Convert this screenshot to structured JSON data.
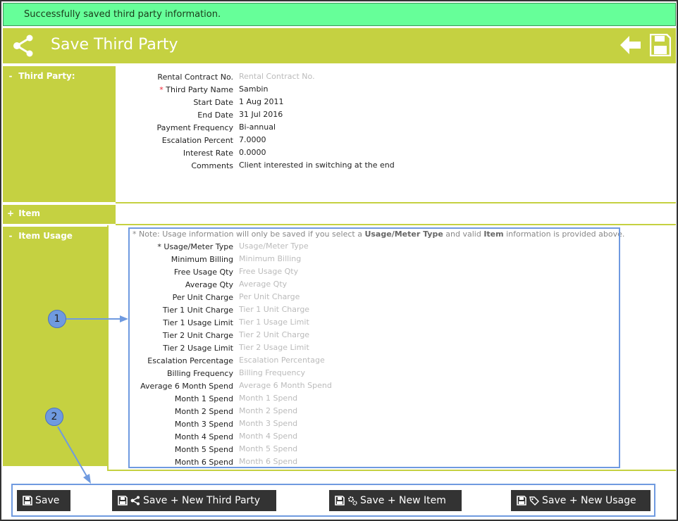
{
  "notification": "Successfully saved third party information.",
  "header": {
    "title": "Save Third Party"
  },
  "sections": {
    "third_party": {
      "toggle": "-",
      "label": "Third Party:"
    },
    "item": {
      "toggle": "+",
      "label": "Item"
    },
    "item_usage": {
      "toggle": "-",
      "label": "Item Usage"
    }
  },
  "third_party_fields": [
    {
      "label": "Rental Contract No.",
      "value": "Rental Contract No.",
      "placeholder": true,
      "required": false
    },
    {
      "label": "Third Party Name",
      "value": "Sambin",
      "placeholder": false,
      "required": true
    },
    {
      "label": "Start Date",
      "value": "1 Aug 2011",
      "placeholder": false,
      "required": false
    },
    {
      "label": "End Date",
      "value": "31 Jul 2016",
      "placeholder": false,
      "required": false
    },
    {
      "label": "Payment Frequency",
      "value": "Bi-annual",
      "placeholder": false,
      "required": false
    },
    {
      "label": "Escalation Percent",
      "value": "7.0000",
      "placeholder": false,
      "required": false
    },
    {
      "label": "Interest Rate",
      "value": "0.0000",
      "placeholder": false,
      "required": false
    },
    {
      "label": "Comments",
      "value": "Client interested in switching at the end",
      "placeholder": false,
      "required": false
    }
  ],
  "usage_note": {
    "prefix": "* Note: Usage information will only be saved if you select a ",
    "bold1": "Usage/Meter Type",
    "middle": " and valid ",
    "bold2": "Item",
    "suffix": " information is provided above."
  },
  "usage_fields": [
    {
      "label": "* Usage/Meter Type",
      "placeholder": "Usage/Meter Type"
    },
    {
      "label": "Minimum Billing",
      "placeholder": "Minimum Billing"
    },
    {
      "label": "Free Usage Qty",
      "placeholder": "Free Usage Qty"
    },
    {
      "label": "Average Qty",
      "placeholder": "Average Qty"
    },
    {
      "label": "Per Unit Charge",
      "placeholder": "Per Unit Charge"
    },
    {
      "label": "Tier 1 Unit Charge",
      "placeholder": "Tier 1 Unit Charge"
    },
    {
      "label": "Tier 1 Usage Limit",
      "placeholder": "Tier 1 Usage Limit"
    },
    {
      "label": "Tier 2 Unit Charge",
      "placeholder": "Tier 2 Unit Charge"
    },
    {
      "label": "Tier 2 Usage Limit",
      "placeholder": "Tier 2 Usage Limit"
    },
    {
      "label": "Escalation Percentage",
      "placeholder": "Escalation Percentage"
    },
    {
      "label": "Billing Frequency",
      "placeholder": "Billing Frequency"
    },
    {
      "label": "Average 6 Month Spend",
      "placeholder": "Average 6 Month Spend"
    },
    {
      "label": "Month 1 Spend",
      "placeholder": "Month 1 Spend"
    },
    {
      "label": "Month 2 Spend",
      "placeholder": "Month 2 Spend"
    },
    {
      "label": "Month 3 Spend",
      "placeholder": "Month 3 Spend"
    },
    {
      "label": "Month 4 Spend",
      "placeholder": "Month 4 Spend"
    },
    {
      "label": "Month 5 Spend",
      "placeholder": "Month 5 Spend"
    },
    {
      "label": "Month 6 Spend",
      "placeholder": "Month 6 Spend"
    }
  ],
  "callouts": [
    "1",
    "2"
  ],
  "buttons": {
    "save": "Save",
    "save_new_third_party": "Save + New Third Party",
    "save_new_item": "Save + New Item",
    "save_new_usage": "Save + New Usage"
  },
  "icons": {
    "header": "share-icon",
    "back": "back-arrow-icon",
    "save": "floppy-disk-icon"
  },
  "colors": {
    "accent": "#c5d141",
    "success_bg": "#66ff99",
    "callout": "#6f9ae0",
    "button_bg": "#333333"
  }
}
